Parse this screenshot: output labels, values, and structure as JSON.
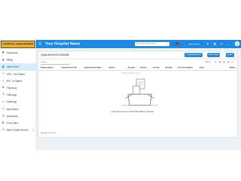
{
  "sidebar": {
    "logo_text": "HOSPITAL MANAGEMENT",
    "items": [
      {
        "label": "Dashboard",
        "icon": "dashboard-icon",
        "glyph": "▦"
      },
      {
        "label": "Billing",
        "icon": "billing-icon",
        "glyph": "▤"
      },
      {
        "label": "Appointment",
        "icon": "appointment-icon",
        "glyph": "▣",
        "active": true
      },
      {
        "label": "OPD - Out Patient",
        "icon": "stethoscope-icon",
        "glyph": "♱"
      },
      {
        "label": "IPD - In Patient",
        "icon": "bed-icon",
        "glyph": "▭"
      },
      {
        "label": "Pharmacy",
        "icon": "pharmacy-icon",
        "glyph": "✚"
      },
      {
        "label": "Pathology",
        "icon": "pathology-icon",
        "glyph": "⚗"
      },
      {
        "label": "Radiology",
        "icon": "radiology-icon",
        "glyph": "◎"
      },
      {
        "label": "Blood Bank",
        "icon": "blood-drop-icon",
        "glyph": "●"
      },
      {
        "label": "Ambulance",
        "icon": "ambulance-icon",
        "glyph": "▰"
      },
      {
        "label": "Front Office",
        "icon": "front-office-icon",
        "glyph": "◧"
      },
      {
        "label": "Birth & Death Record",
        "icon": "record-icon",
        "glyph": "◫",
        "has_caret": true
      }
    ]
  },
  "header": {
    "menu_icon": "hamburger-menu-icon",
    "title": "Your Hospital Name",
    "search_placeholder": "Search By Patient Name",
    "current_user": "Ravi Gowne",
    "accent": "#1e88e5"
  },
  "main": {
    "title": "Appointment Details",
    "buttons": {
      "add": "+ Add Appointment",
      "doctor_wise": "Doctor Wise",
      "queue": "Queue"
    },
    "search_placeholder": "Search...",
    "rows_per_page": "100 ▾",
    "columns": [
      "Patient Name",
      "Appointment No",
      "Appointment Date",
      "Phone",
      "Gender",
      "Doctor",
      "Source",
      "Priority",
      "Live Consultant",
      "Fees",
      "Status"
    ],
    "no_data_text": "No data available in table",
    "empty_hint": "Add new record or search with different criteria.",
    "records_text": "Records: 0 to 0 of 0"
  }
}
